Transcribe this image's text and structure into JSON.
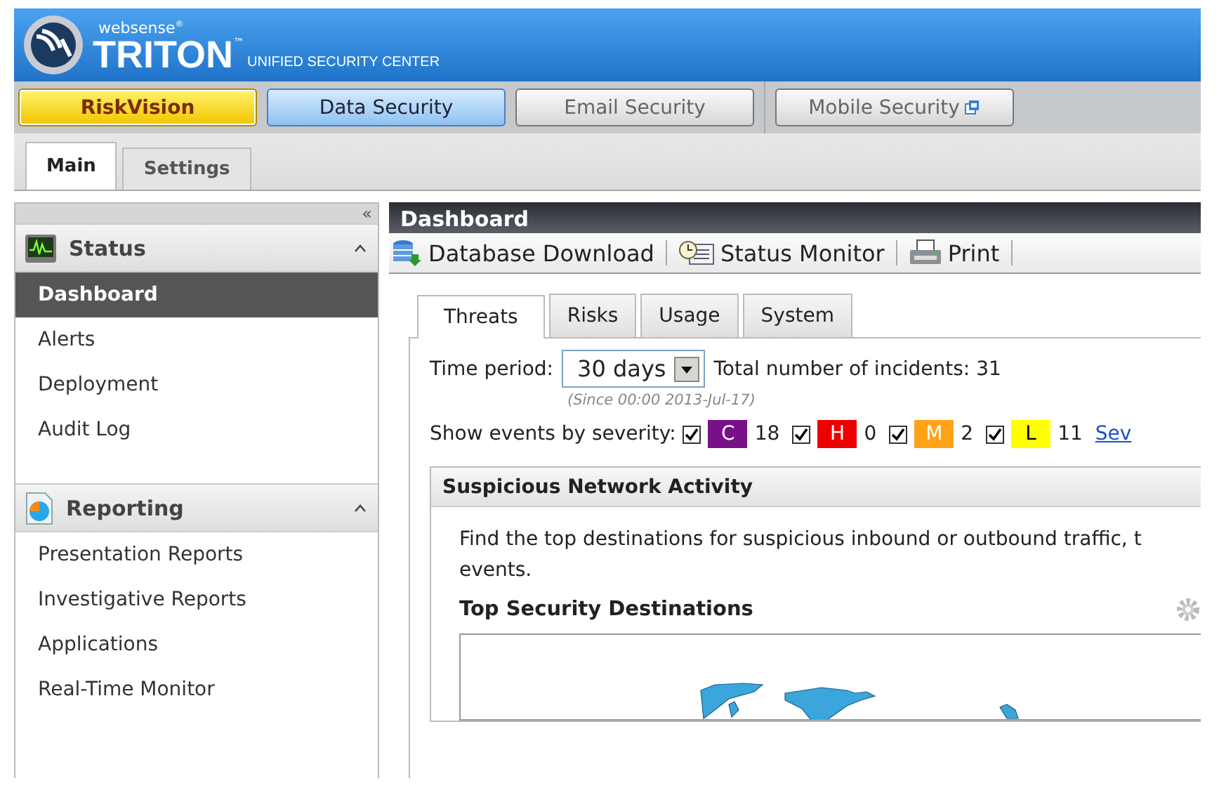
{
  "header": {
    "brand_small": "websense",
    "brand_mark": "®",
    "product": "TRITON",
    "tm": "™",
    "subtitle": "UNIFIED SECURITY CENTER"
  },
  "modules": [
    {
      "label": "RiskVision",
      "kind": "risk",
      "selected": true
    },
    {
      "label": "Data Security",
      "kind": "data",
      "selected": false
    },
    {
      "label": "Email Security",
      "kind": "plain",
      "selected": false
    },
    {
      "label": "Mobile Security",
      "kind": "external",
      "selected": false
    }
  ],
  "main_tabs": [
    {
      "label": "Main",
      "selected": true
    },
    {
      "label": "Settings",
      "selected": false
    }
  ],
  "sidebar": {
    "collapse": "«",
    "sections": [
      {
        "title": "Status",
        "expanded": true,
        "items": [
          {
            "label": "Dashboard",
            "selected": true
          },
          {
            "label": "Alerts",
            "selected": false
          },
          {
            "label": "Deployment",
            "selected": false
          },
          {
            "label": "Audit Log",
            "selected": false
          }
        ]
      },
      {
        "title": "Reporting",
        "expanded": true,
        "items": [
          {
            "label": "Presentation Reports",
            "selected": false
          },
          {
            "label": "Investigative Reports",
            "selected": false
          },
          {
            "label": "Applications",
            "selected": false
          },
          {
            "label": "Real-Time Monitor",
            "selected": false
          }
        ]
      }
    ]
  },
  "page": {
    "title": "Dashboard",
    "toolbar": [
      {
        "label": "Database Download"
      },
      {
        "label": "Status Monitor"
      },
      {
        "label": "Print"
      }
    ],
    "tabs": [
      {
        "label": "Threats",
        "selected": true
      },
      {
        "label": "Risks",
        "selected": false
      },
      {
        "label": "Usage",
        "selected": false
      },
      {
        "label": "System",
        "selected": false
      }
    ],
    "time_label": "Time period:",
    "time_value": "30 days",
    "total": "Total number of incidents: 31",
    "since": "(Since 00:00 2013-Jul-17)",
    "severity_label": "Show events by severity:",
    "severities": [
      {
        "letter": "C",
        "count": "18",
        "checked": true,
        "color": "#7a0f8a"
      },
      {
        "letter": "H",
        "count": "0",
        "checked": true,
        "color": "#ee0000"
      },
      {
        "letter": "M",
        "count": "2",
        "checked": true,
        "color": "#ffa21a"
      },
      {
        "letter": "L",
        "count": "11",
        "checked": true,
        "color": "#ffff00"
      }
    ],
    "severity_link": "Sev",
    "panel": {
      "title": "Suspicious Network Activity",
      "lines": [
        "Find the top destinations for suspicious inbound or outbound traffic, t",
        "events."
      ],
      "chart_title": "Top Security Destinations"
    }
  }
}
